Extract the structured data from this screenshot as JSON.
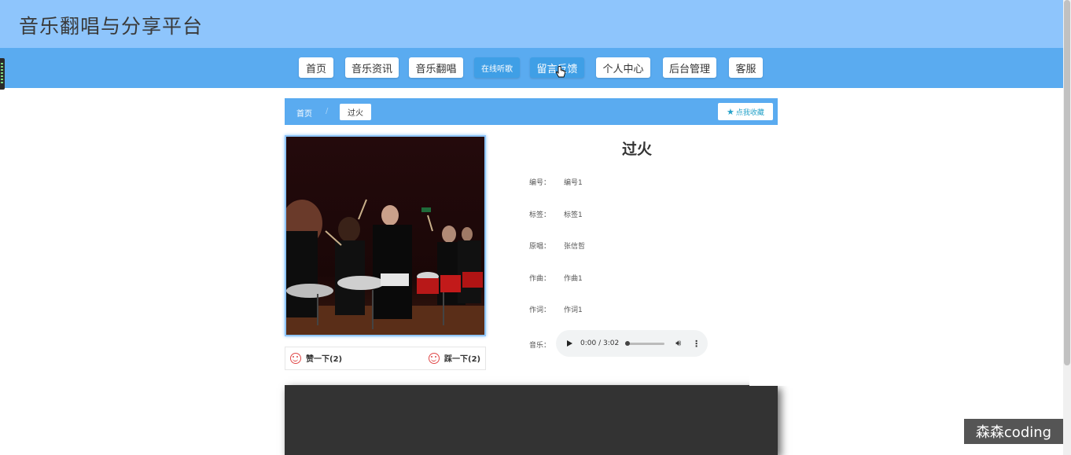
{
  "site": {
    "title": "音乐翻唱与分享平台"
  },
  "nav": {
    "items": [
      {
        "label": "首页"
      },
      {
        "label": "音乐资讯"
      },
      {
        "label": "音乐翻唱"
      },
      {
        "label": "在线听歌"
      },
      {
        "label": "留言反馈"
      },
      {
        "label": "个人中心"
      },
      {
        "label": "后台管理"
      },
      {
        "label": "客服"
      }
    ],
    "active": "在线听歌"
  },
  "breadcrumb": {
    "home": "首页",
    "separator": "/",
    "current": "过火"
  },
  "favorite": {
    "label": "点我收藏",
    "icon": "star-icon"
  },
  "detail": {
    "title": "过火",
    "fields": [
      {
        "label": "编号：",
        "value": "编号1"
      },
      {
        "label": "标签：",
        "value": "标签1"
      },
      {
        "label": "原唱：",
        "value": "张信哲"
      },
      {
        "label": "作曲：",
        "value": "作曲1"
      },
      {
        "label": "作词：",
        "value": "作词1"
      }
    ],
    "music_label": "音乐：",
    "audio": {
      "time": "0:00 / 3:02"
    }
  },
  "votes": {
    "like": "赞一下(2)",
    "dislike": "踩一下(2)"
  },
  "watermark": "森森coding",
  "colors": {
    "header": "#8ec5fc",
    "nav": "#5aabf0",
    "active": "#3f9fe6",
    "accent": "#26a2c9"
  }
}
